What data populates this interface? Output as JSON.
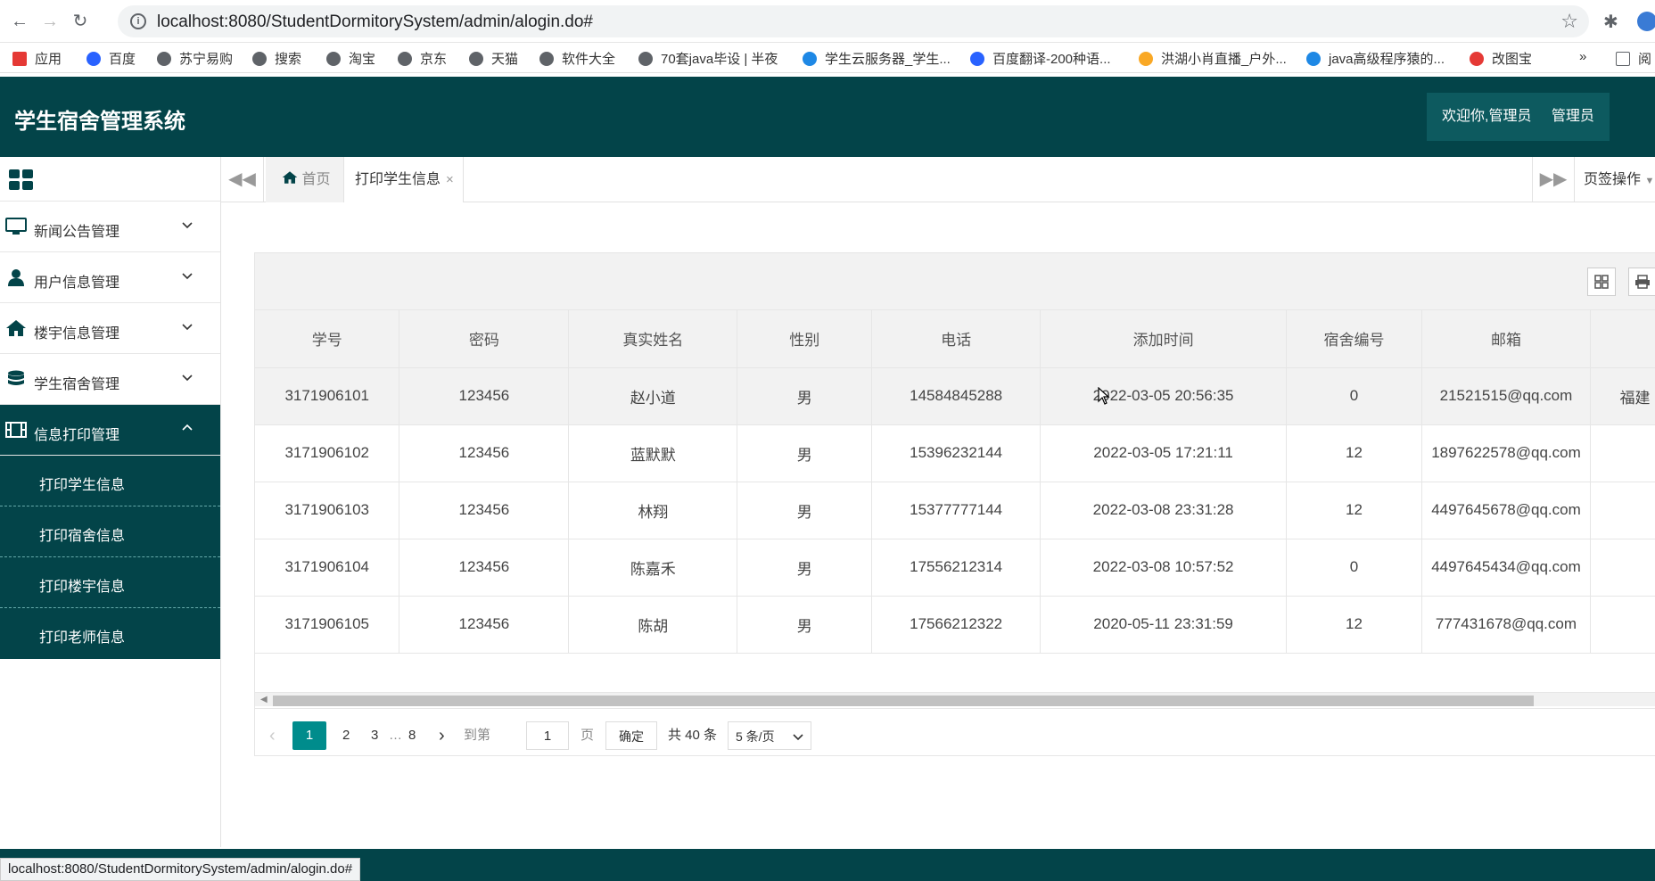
{
  "browser": {
    "url": "localhost:8080/StudentDormitorySystem/admin/alogin.do#",
    "status_url": "localhost:8080/StudentDormitorySystem/admin/alogin.do#",
    "bookmarks": [
      "应用",
      "百度",
      "苏宁易购",
      "搜索",
      "淘宝",
      "京东",
      "天猫",
      "软件大全",
      "70套java毕设 | 半夜",
      "学生云服务器_学生...",
      "百度翻译-200种语...",
      "洪湖小肖直播_户外...",
      "java高级程序猿的...",
      "改图宝"
    ],
    "more_bookmarks": "»",
    "reading_list": "阅"
  },
  "header": {
    "title": "学生宿舍管理系统",
    "welcome": "欢迎你,管理员",
    "role": "管理员"
  },
  "sidebar": {
    "menus": [
      {
        "label": "新闻公告管理",
        "icon": "monitor-icon"
      },
      {
        "label": "用户信息管理",
        "icon": "user-icon"
      },
      {
        "label": "楼宇信息管理",
        "icon": "home-icon"
      },
      {
        "label": "学生宿舍管理",
        "icon": "database-icon"
      },
      {
        "label": "信息打印管理",
        "icon": "film-icon"
      }
    ],
    "submenus": [
      "打印学生信息",
      "打印宿舍信息",
      "打印楼宇信息",
      "打印老师信息"
    ]
  },
  "tabs": {
    "home": "首页",
    "current": "打印学生信息",
    "close": "×",
    "ops": "页签操作"
  },
  "table": {
    "columns": [
      "学号",
      "密码",
      "真实姓名",
      "性别",
      "电话",
      "添加时间",
      "宿舍编号",
      "邮箱"
    ],
    "rows": [
      [
        "3171906101",
        "123456",
        "赵小道",
        "男",
        "14584845288",
        "2022-03-05 20:56:35",
        "0",
        "21521515@qq.com",
        "福建"
      ],
      [
        "3171906102",
        "123456",
        "蓝默默",
        "男",
        "15396232144",
        "2022-03-05 17:21:11",
        "12",
        "1897622578@qq.com",
        ""
      ],
      [
        "3171906103",
        "123456",
        "林翔",
        "男",
        "15377777144",
        "2022-03-08 23:31:28",
        "12",
        "4497645678@qq.com",
        ""
      ],
      [
        "3171906104",
        "123456",
        "陈嘉禾",
        "男",
        "17556212314",
        "2022-03-08 10:57:52",
        "0",
        "4497645434@qq.com",
        ""
      ],
      [
        "3171906105",
        "123456",
        "陈胡",
        "男",
        "17566212322",
        "2020-05-11 23:31:59",
        "12",
        "777431678@qq.com",
        ""
      ]
    ]
  },
  "pager": {
    "pages": [
      "1",
      "2",
      "3",
      "…",
      "8"
    ],
    "goto_label": "到第",
    "goto_value": "1",
    "page_unit": "页",
    "confirm": "确定",
    "total": "共 40 条",
    "per_page": "5 条/页"
  }
}
